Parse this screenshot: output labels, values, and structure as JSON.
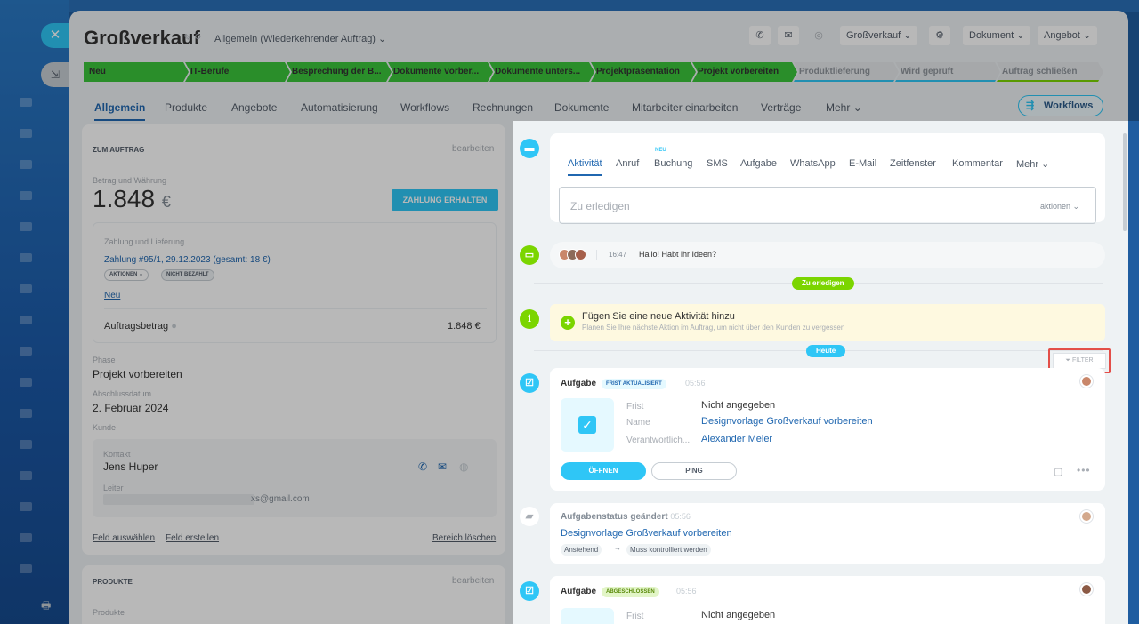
{
  "header": {
    "title": "Großverkauf",
    "category": "Allgemein (Wiederkehrender Auftrag)",
    "pipeline_label": "Großverkauf",
    "document_label": "Dokument",
    "offer_label": "Angebot"
  },
  "stages": [
    "Neu",
    "IT-Berufe",
    "Besprechung der B...",
    "Dokumente vorber...",
    "Dokumente unters...",
    "Projektpräsentation",
    "Projekt vorbereiten",
    "Produktlieferung",
    "Wird geprüft",
    "Auftrag schließen"
  ],
  "tabs": [
    "Allgemein",
    "Produkte",
    "Angebote",
    "Automatisierung",
    "Workflows",
    "Rechnungen",
    "Dokumente",
    "Mitarbeiter einarbeiten",
    "Verträge",
    "Mehr"
  ],
  "workflows_label": "Workflows",
  "order_card": {
    "title": "ZUM AUFTRAG",
    "edit_label": "bearbeiten",
    "amount_label": "Betrag und Währung",
    "amount": "1.848",
    "currency": "€",
    "pay_button": "ZAHLUNG ERHALTEN",
    "payment_section_label": "Zahlung und Lieferung",
    "payment_link": "Zahlung #95/1, 29.12.2023 (gesamt: 18 €)",
    "actions_pill": "AKTIONEN",
    "unpaid_pill": "NICHT BEZAHLT",
    "new_link": "Neu",
    "order_amount_label": "Auftragsbetrag",
    "order_amount_value": "1.848 €",
    "phase_label": "Phase",
    "phase_value": "Projekt vorbereiten",
    "close_date_label": "Abschlussdatum",
    "close_date_value": "2. Februar 2024",
    "customer_label": "Kunde",
    "contact_label": "Kontakt",
    "contact_name": "Jens Huper",
    "contact_role": "Leiter",
    "contact_email": "xs@gmail.com",
    "select_field": "Feld auswählen",
    "create_field": "Feld erstellen",
    "delete_section": "Bereich löschen"
  },
  "products_card": {
    "title": "PRODUKTE",
    "edit_label": "bearbeiten",
    "products_label": "Produkte"
  },
  "editor": {
    "tabs": [
      "Aktivität",
      "Anruf",
      "Buchung",
      "SMS",
      "Aufgabe",
      "WhatsApp",
      "E-Mail",
      "Zeitfenster",
      "Kommentar",
      "Mehr"
    ],
    "new_badge": "NEU",
    "placeholder": "Zu erledigen",
    "actions_label": "aktionen"
  },
  "chat": {
    "time": "16:47",
    "message": "Hallo! Habt ihr Ideen?"
  },
  "todo_separator": "Zu erledigen",
  "add_activity": {
    "title": "Fügen Sie eine neue Aktivität hinzu",
    "subtitle": "Planen Sie Ihre nächste Aktion im Auftrag, um nicht über den Kunden zu vergessen"
  },
  "today_separator": "Heute",
  "filter_label": "FILTER",
  "task1": {
    "type": "Aufgabe",
    "tag": "FRIST AKTUALISIERT",
    "time": "05:56",
    "deadline_label": "Frist",
    "deadline_value": "Nicht angegeben",
    "name_label": "Name",
    "name_value": "Designvorlage Großverkauf vorbereiten",
    "responsible_label": "Verantwortlich...",
    "responsible_value": "Alexander Meier",
    "open_button": "ÖFFNEN",
    "ping_button": "PING"
  },
  "status_change": {
    "title": "Aufgabenstatus geändert",
    "time": "05:56",
    "link": "Designvorlage Großverkauf vorbereiten",
    "from": "Anstehend",
    "arrow": "→",
    "to": "Muss kontrolliert werden"
  },
  "task2": {
    "type": "Aufgabe",
    "tag": "ABGESCHLOSSEN",
    "time": "05:56",
    "deadline_label": "Frist",
    "deadline_value": "Nicht angegeben"
  },
  "colors": {
    "accent": "#2067b0",
    "cyan": "#2fc6f6",
    "green": "#7bd500",
    "stage_green": "#3bc53b",
    "highlight": "#e34e48"
  }
}
